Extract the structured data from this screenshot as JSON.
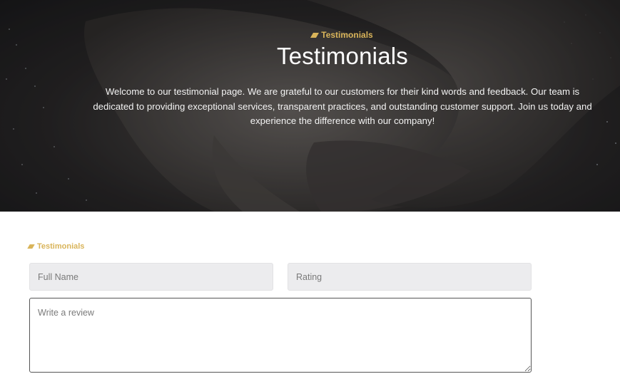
{
  "hero": {
    "tag": "Testimonials",
    "title": "Testimonials",
    "description": "Welcome to our testimonial page. We are grateful to our customers for their kind words and feedback. Our team is dedicated to providing exceptional services, transparent practices, and outstanding customer support. Join us today and experience the difference with our company!"
  },
  "form": {
    "tag": "Testimonials",
    "full_name": {
      "placeholder": "Full Name",
      "value": ""
    },
    "rating": {
      "placeholder": "Rating",
      "value": ""
    },
    "review": {
      "placeholder": "Write a review",
      "value": ""
    }
  },
  "colors": {
    "accent": "#d9b45a",
    "hero_dark": "#1a1a1c",
    "field_bg": "#ececee"
  }
}
